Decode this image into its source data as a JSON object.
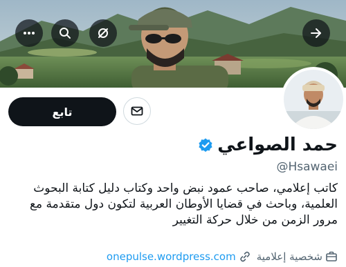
{
  "profile": {
    "display_name": "حمد الصواعي",
    "handle": "@Hsawaei",
    "verified": true,
    "bio_lines": [
      "كاتب إعلامي، صاحب عمود نبض واحد وكتاب دليل كتابة البحوث",
      "العلمية، وباحث في قضايا الأوطان العربية لتكون دول متقدمة مع",
      "مرور الزمن من خلال حركة التغيير"
    ],
    "category": "شخصية إعلامية",
    "website": "onepulse.wordpress.com"
  },
  "actions": {
    "follow_label": "تابع"
  },
  "icons": {
    "more": "more-icon",
    "search": "search-icon",
    "grok": "grok-icon",
    "forward": "arrow-right-icon",
    "message": "envelope-icon",
    "verified": "verified-badge-icon",
    "category": "briefcase-icon",
    "link": "link-icon"
  },
  "colors": {
    "accent": "#1d9bf0",
    "text": "#0f1419",
    "secondary": "#536471",
    "button_dark": "#0f1419"
  }
}
